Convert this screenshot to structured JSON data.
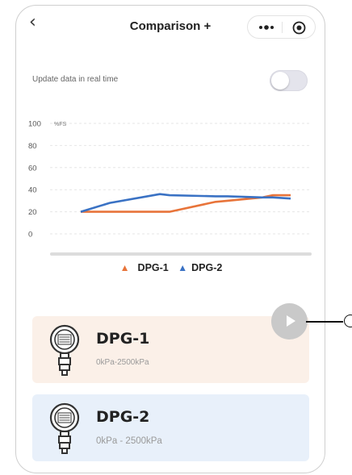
{
  "nav": {
    "title": "Comparison +",
    "back_icon": "chevron-left-icon",
    "more_icon": "more-dots-icon",
    "close_icon": "target-icon"
  },
  "realtime": {
    "label": "Update data in real time",
    "enabled": false
  },
  "chart_data": {
    "type": "line",
    "yunit": "%FS",
    "yticks": [
      "100",
      "80",
      "60",
      "40",
      "20",
      "0"
    ],
    "ylim": [
      0,
      100
    ],
    "grid": true,
    "legend_position": "bottom",
    "series": [
      {
        "name": "DPG-1",
        "color": "#e8743a",
        "x": [
          0,
          1,
          2,
          3,
          4,
          5,
          6,
          7,
          8
        ],
        "values": [
          20,
          20,
          20,
          20,
          29,
          30,
          33,
          35,
          35
        ]
      },
      {
        "name": "DPG-2",
        "color": "#3a72c4",
        "x": [
          0,
          1,
          2,
          3,
          4,
          5,
          6,
          7,
          8
        ],
        "values": [
          20,
          28,
          36,
          35,
          34,
          34,
          33,
          33,
          32
        ]
      }
    ]
  },
  "legend": {
    "items": [
      {
        "label": "DPG-1",
        "color": "#e8743a"
      },
      {
        "label": "DPG-2",
        "color": "#3a72c4"
      }
    ]
  },
  "devices": [
    {
      "name": "DPG-1",
      "range": "0kPa-2500kPa",
      "bg": "#fbf0e8"
    },
    {
      "name": "DPG-2",
      "range": "0kPa - 2500kPa",
      "bg": "#e8f0fa"
    }
  ],
  "play_button": {
    "icon": "play-icon"
  }
}
